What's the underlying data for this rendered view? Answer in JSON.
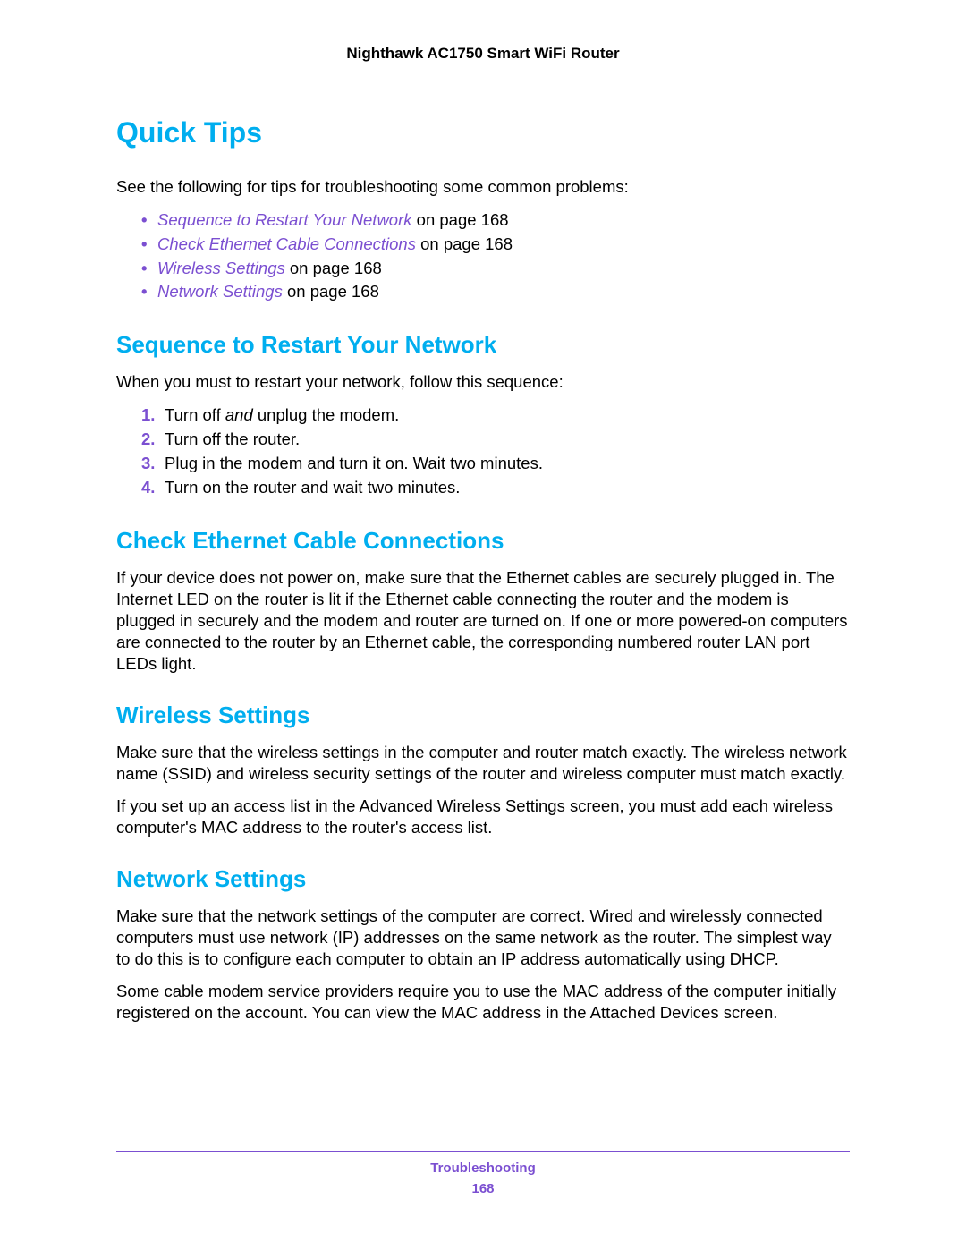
{
  "header": {
    "product_title": "Nighthawk AC1750 Smart WiFi Router"
  },
  "main": {
    "h1": "Quick Tips",
    "intro": "See the following for tips for troubleshooting some common problems:",
    "links": [
      {
        "label": "Sequence to Restart Your Network",
        "suffix": " on page 168"
      },
      {
        "label": "Check Ethernet Cable Connections",
        "suffix": " on page 168"
      },
      {
        "label": "Wireless Settings",
        "suffix": " on page 168"
      },
      {
        "label": "Network Settings",
        "suffix": " on page 168"
      }
    ],
    "sections": {
      "sequence": {
        "title": "Sequence to Restart Your Network",
        "intro": "When you must to restart your network, follow this sequence:",
        "steps_pre": "Turn off ",
        "steps_em": "and",
        "steps_post": " unplug the modem.",
        "step2": "Turn off the router.",
        "step3": "Plug in the modem and turn it on. Wait two minutes.",
        "step4": "Turn on the router and wait two minutes."
      },
      "ethernet": {
        "title": "Check Ethernet Cable Connections",
        "para": "If your device does not power on, make sure that the Ethernet cables are securely plugged in. The Internet LED on the router is lit if the Ethernet cable connecting the router and the modem is plugged in securely and the modem and router are turned on. If one or more powered-on computers are connected to the router by an Ethernet cable, the corresponding numbered router LAN port LEDs light."
      },
      "wireless": {
        "title": "Wireless Settings",
        "para1": "Make sure that the wireless settings in the computer and router match exactly. The wireless network name (SSID) and wireless security settings of the router and wireless computer must match exactly.",
        "para2": "If you set up an access list in the Advanced Wireless Settings screen, you must add each wireless computer's MAC address to the router's access list."
      },
      "network": {
        "title": "Network Settings",
        "para1": "Make sure that the network settings of the computer are correct. Wired and wirelessly connected computers must use network (IP) addresses on the same network as the router. The simplest way to do this is to configure each computer to obtain an IP address automatically using DHCP.",
        "para2": "Some cable modem service providers require you to use the MAC address of the computer initially registered on the account. You can view the MAC address in the Attached Devices screen."
      }
    }
  },
  "footer": {
    "section": "Troubleshooting",
    "page": "168"
  }
}
